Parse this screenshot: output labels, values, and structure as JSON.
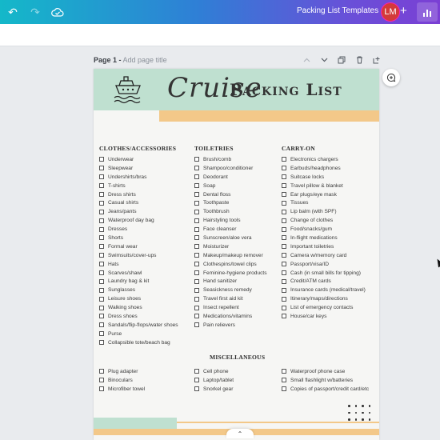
{
  "topbar": {
    "title": "Packing List Templates",
    "avatar_initials": "LM",
    "plus_label": "+",
    "accent_start": "#14b8c9",
    "accent_end": "#7b3fd4"
  },
  "page_header": {
    "page_label": "Page 1 -",
    "title_placeholder": "Add page title"
  },
  "document": {
    "title_script": "Cruise",
    "title_main": "Packing List",
    "colors": {
      "mint": "#bfe0d0",
      "peach": "#f3c889"
    },
    "columns": [
      {
        "heading": "CLOTHES/ACCESSORIES",
        "items": [
          "Underwear",
          "Sleepwear",
          "Undershirts/bras",
          "T-shirts",
          "Dress shirts",
          "Casual shirts",
          "Jeans/pants",
          "Waterproof day bag",
          "Dresses",
          "Shorts",
          "Formal wear",
          "Swimsuits/cover-ups",
          "Hats",
          "Scarves/shawl",
          "Laundry bag & kit",
          "Sunglasses",
          "Leisure shoes",
          "Walking shoes",
          "Dress shoes",
          "Sandals/flip-flops/water shoes",
          "Purse",
          "Collapsible tote/beach bag"
        ]
      },
      {
        "heading": "TOILETRIES",
        "items": [
          "Brush/comb",
          "Shampoo/conditioner",
          "Deodorant",
          "Soap",
          "Dental floss",
          "Toothpaste",
          "Toothbrush",
          "Hairstyling tools",
          "Face cleanser",
          "Sunscreen/aloe vera",
          "Moisturizer",
          "Makeup/makeup remover",
          "Clothespins/towel clips",
          "Feminine-hygiene products",
          "Hand sanitizer",
          "Seasickness remedy",
          "Travel first aid kit",
          "Insect repellent",
          "Medications/vitamins",
          "Pain relievers"
        ]
      },
      {
        "heading": "CARRY-ON",
        "items": [
          "Electronics chargers",
          "Earbuds/headphones",
          "Suitcase locks",
          "Travel pillow & blanket",
          "Ear plugs/eye mask",
          "Tissues",
          "Lip balm (with SPF)",
          "Change of clothes",
          "Food/snacks/gum",
          "In-flight medications",
          "Important toiletries",
          "Camera w/memory card",
          "Passport/visa/ID",
          "Cash (in small bills for tipping)",
          "Credit/ATM cards",
          "Insurance cards (medical/travel)",
          "Itinerary/maps/directions",
          "List of emergency contacts",
          "House/car keys"
        ]
      }
    ],
    "misc": {
      "heading": "MISCELLANEOUS",
      "columns": [
        [
          "Plug adapter",
          "Binoculars",
          "Microfiber towel"
        ],
        [
          "Cell phone",
          "Laptop/tablet",
          "Snorkel gear"
        ],
        [
          "Waterproof phone case",
          "Small flashlight w/batteries",
          "Copies of passport/credit card/etc"
        ]
      ]
    }
  }
}
